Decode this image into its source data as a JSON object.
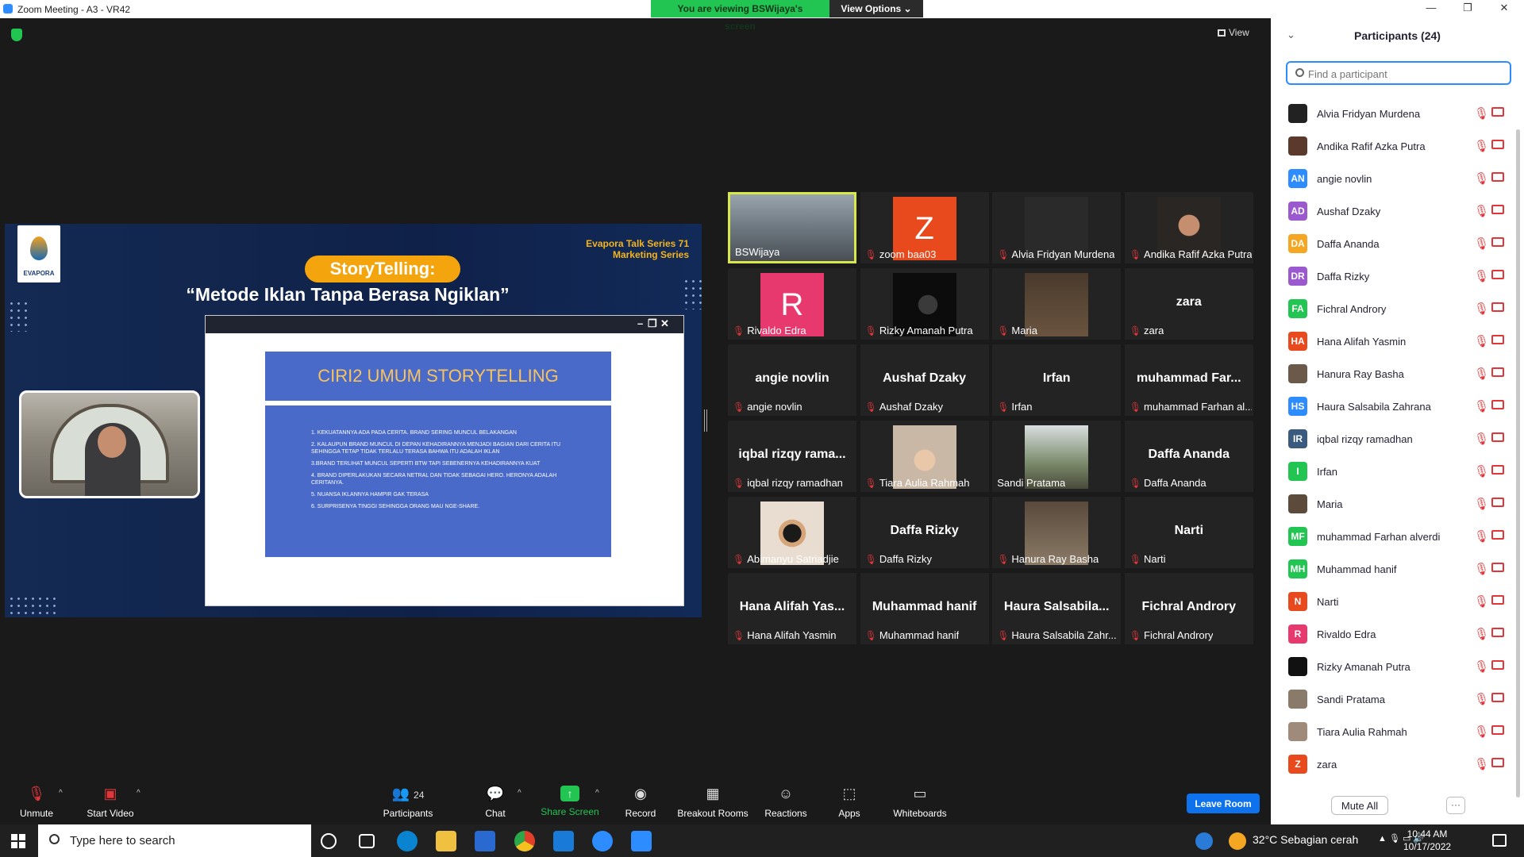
{
  "window": {
    "title": "Zoom Meeting - A3 - VR42",
    "minimize": "—",
    "restore": "❐",
    "close": "✕"
  },
  "banner": {
    "viewing": "You are viewing BSWijaya's screen",
    "view_options": "View Options ⌄"
  },
  "view_button": "View",
  "share": {
    "logo": "EVAPORA",
    "series_line1": "Evapora Talk Series 71",
    "series_line2": "Marketing Series",
    "pill": "StoryTelling:",
    "subtitle": "“Metode Iklan Tanpa Berasa Ngiklan”",
    "ppt_controls": {
      "minimize": "–",
      "restore": "❐",
      "close": "✕"
    },
    "slide_title": "CIRI2 UMUM STORYTELLING",
    "slide_points": [
      "1. KEKUATANNYA ADA PADA CERITA. BRAND  SERING MUNCUL BELAKANGAN",
      "2. KALAUPUN BRAND MUNCUL DI DEPAN KEHADIRANNYA MENJADI BAGIAN DARI CERITA ITU SEHINGGA TETAP TIDAK TERLALU TERASA BAHWA ITU ADALAH IKLAN",
      "3.BRAND TERLIHAT MUNCUL SEPERTI BTW TAPI SEBENERNYA KEHADIRANNYA KUAT",
      "4. BRAND DIPERLAKUKAN SECARA NETRAL DAN TIDAK SEBAGAI HERO. HERONYA ADALAH  CERITANYA.",
      "5. NUANSA IKLANNYA HAMPIR GAK TERASA",
      "6. SURPRISENYA TINGGI SEHINGGA ORANG MAU NGE-SHARE."
    ]
  },
  "gallery": [
    {
      "name": "BSWijaya",
      "big": "",
      "avatar": "",
      "color": "",
      "photo": "city",
      "muted": false,
      "active": true
    },
    {
      "name": "zoom baa03",
      "big": "",
      "avatar": "Z",
      "color": "#e8491d",
      "photo": "",
      "muted": true
    },
    {
      "name": "Alvia Fridyan Murdena",
      "big": "",
      "avatar": "",
      "color": "#232323",
      "photo": "dark",
      "muted": true
    },
    {
      "name": "Andika Rafif Azka Putra",
      "big": "",
      "avatar": "",
      "color": "",
      "photo": "face",
      "muted": true
    },
    {
      "name": "Rivaldo Edra",
      "big": "",
      "avatar": "R",
      "color": "#e8396f",
      "photo": "",
      "muted": true
    },
    {
      "name": "Rizky Amanah Putra",
      "big": "",
      "avatar": "",
      "color": "",
      "photo": "black",
      "muted": true
    },
    {
      "name": "Maria",
      "big": "",
      "avatar": "",
      "color": "",
      "photo": "brown",
      "muted": true
    },
    {
      "name": "zara",
      "big": "zara",
      "avatar": "",
      "color": "",
      "photo": "",
      "muted": true
    },
    {
      "name": "angie novlin",
      "big": "angie novlin",
      "avatar": "",
      "color": "",
      "photo": "",
      "muted": true
    },
    {
      "name": "Aushaf Dzaky",
      "big": "Aushaf Dzaky",
      "avatar": "",
      "color": "",
      "photo": "",
      "muted": true
    },
    {
      "name": "Irfan",
      "big": "Irfan",
      "avatar": "",
      "color": "",
      "photo": "",
      "muted": true
    },
    {
      "name": "muhammad Farhan al...",
      "big": "muhammad  Far...",
      "avatar": "",
      "color": "",
      "photo": "",
      "muted": true
    },
    {
      "name": "iqbal rizqy ramadhan",
      "big": "iqbal  rizqy  rama...",
      "avatar": "",
      "color": "",
      "photo": "",
      "muted": true
    },
    {
      "name": "Tiara Aulia Rahmah",
      "big": "",
      "avatar": "",
      "color": "",
      "photo": "baby",
      "muted": true
    },
    {
      "name": "Sandi Pratama",
      "big": "",
      "avatar": "",
      "color": "",
      "photo": "street",
      "muted": false
    },
    {
      "name": "Daffa Ananda",
      "big": "Daffa Ananda",
      "avatar": "",
      "color": "",
      "photo": "",
      "muted": true
    },
    {
      "name": "Abimanyu Satriadjie",
      "big": "",
      "avatar": "",
      "color": "",
      "photo": "mask",
      "muted": true
    },
    {
      "name": "Daffa Rizky",
      "big": "Daffa Rizky",
      "avatar": "",
      "color": "",
      "photo": "",
      "muted": true
    },
    {
      "name": "Hanura Ray Basha",
      "big": "",
      "avatar": "",
      "color": "",
      "photo": "room",
      "muted": true
    },
    {
      "name": "Narti",
      "big": "Narti",
      "avatar": "",
      "color": "",
      "photo": "",
      "muted": true
    },
    {
      "name": "Hana Alifah Yasmin",
      "big": "Hana  Alifah  Yas...",
      "avatar": "",
      "color": "",
      "photo": "",
      "muted": true
    },
    {
      "name": "Muhammad hanif",
      "big": "Muhammad hanif",
      "avatar": "",
      "color": "",
      "photo": "",
      "muted": true
    },
    {
      "name": "Haura Salsabila Zahr...",
      "big": "Haura  Salsabila...",
      "avatar": "",
      "color": "",
      "photo": "",
      "muted": true
    },
    {
      "name": "Fichral Androry",
      "big": "Fichral Androry",
      "avatar": "",
      "color": "",
      "photo": "",
      "muted": true
    }
  ],
  "panel": {
    "title": "Participants (24)",
    "search_placeholder": "Find a participant",
    "participants": [
      {
        "name": "Alvia Fridyan Murdena",
        "initials": "",
        "color": "#222222"
      },
      {
        "name": "Andika Rafif Azka Putra",
        "initials": "",
        "color": "#5a3a2a"
      },
      {
        "name": "angie novlin",
        "initials": "AN",
        "color": "#2d8cff"
      },
      {
        "name": "Aushaf Dzaky",
        "initials": "AD",
        "color": "#9b59d0"
      },
      {
        "name": "Daffa Ananda",
        "initials": "DA",
        "color": "#f5a623"
      },
      {
        "name": "Daffa Rizky",
        "initials": "DR",
        "color": "#9b59d0"
      },
      {
        "name": "Fichral Androry",
        "initials": "FA",
        "color": "#23c552"
      },
      {
        "name": "Hana Alifah Yasmin",
        "initials": "HA",
        "color": "#e8491d"
      },
      {
        "name": "Hanura Ray Basha",
        "initials": "",
        "color": "#6b5a4a"
      },
      {
        "name": "Haura Salsabila Zahrana",
        "initials": "HS",
        "color": "#2d8cff"
      },
      {
        "name": "iqbal rizqy ramadhan",
        "initials": "IR",
        "color": "#3a5a80"
      },
      {
        "name": "Irfan",
        "initials": "I",
        "color": "#23c552"
      },
      {
        "name": "Maria",
        "initials": "",
        "color": "#5c4a3a"
      },
      {
        "name": "muhammad Farhan alverdi",
        "initials": "MF",
        "color": "#23c552"
      },
      {
        "name": "Muhammad hanif",
        "initials": "MH",
        "color": "#23c552"
      },
      {
        "name": "Narti",
        "initials": "N",
        "color": "#e8491d"
      },
      {
        "name": "Rivaldo Edra",
        "initials": "R",
        "color": "#e8396f"
      },
      {
        "name": "Rizky Amanah Putra",
        "initials": "",
        "color": "#111111"
      },
      {
        "name": "Sandi Pratama",
        "initials": "",
        "color": "#8a7a6a"
      },
      {
        "name": "Tiara Aulia Rahmah",
        "initials": "",
        "color": "#a08a7a"
      },
      {
        "name": "zara",
        "initials": "Z",
        "color": "#e8491d"
      }
    ],
    "mute_all": "Mute All",
    "more": "···"
  },
  "toolbar": {
    "unmute": "Unmute",
    "start_video": "Start Video",
    "participants": "Participants",
    "participants_count": "24",
    "chat": "Chat",
    "share_screen": "Share Screen",
    "record": "Record",
    "breakout": "Breakout Rooms",
    "reactions": "Reactions",
    "apps": "Apps",
    "whiteboards": "Whiteboards",
    "leave": "Leave Room"
  },
  "taskbar": {
    "search": "Type here to search",
    "weather": "32°C  Sebagian cerah",
    "time": "10:44 AM",
    "date": "10/17/2022"
  },
  "colors": {
    "accent": "#2d8cff",
    "muted_red": "#e0363a",
    "share_green": "#23c552",
    "leave_blue": "#0e72ed"
  }
}
